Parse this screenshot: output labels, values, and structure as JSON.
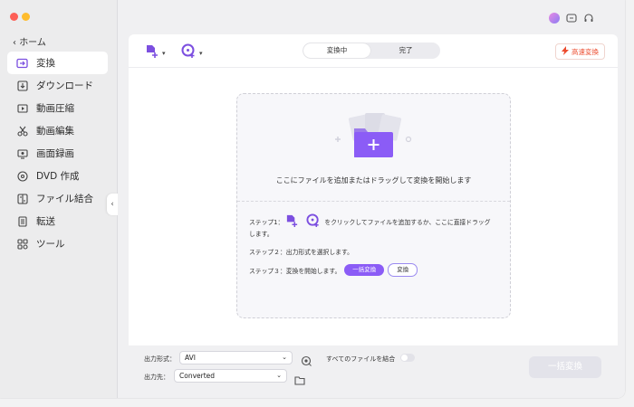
{
  "window": {
    "home_label": "ホーム"
  },
  "sidebar": {
    "items": [
      {
        "label": "変換",
        "icon": "convert-icon",
        "active": true
      },
      {
        "label": "ダウンロード",
        "icon": "download-icon"
      },
      {
        "label": "動画圧縮",
        "icon": "compress-icon"
      },
      {
        "label": "動画編集",
        "icon": "scissors-icon"
      },
      {
        "label": "画面録画",
        "icon": "screen-record-icon"
      },
      {
        "label": "DVD 作成",
        "icon": "dvd-icon"
      },
      {
        "label": "ファイル結合",
        "icon": "merge-icon"
      },
      {
        "label": "転送",
        "icon": "transfer-icon"
      },
      {
        "label": "ツール",
        "icon": "toolbox-icon"
      }
    ]
  },
  "tabs": {
    "converting": "変換中",
    "done": "完了"
  },
  "speed_button": "高速変換",
  "drop": {
    "title": "ここにファイルを追加またはドラッグして変換を開始します",
    "step1_prefix": "ステップ1：",
    "step1_suffix": "をクリックしてファイルを追加するか、ここに直接ドラッグ",
    "step1_line2": "します。",
    "step2": "ステップ２：出力形式を選択します。",
    "step3": "ステップ３：変換を開始します。",
    "batch_btn": "一括変換",
    "convert_btn": "変換"
  },
  "bottom": {
    "format_label": "出力形式：",
    "format_value": "AVI",
    "dest_label": "出力先：",
    "dest_value": "Converted",
    "merge_label": "すべてのファイルを結合",
    "merge_on": false,
    "convert_all": "一括変換"
  },
  "colors": {
    "accent": "#8b5cf6",
    "speed": "#ec4b2e"
  }
}
